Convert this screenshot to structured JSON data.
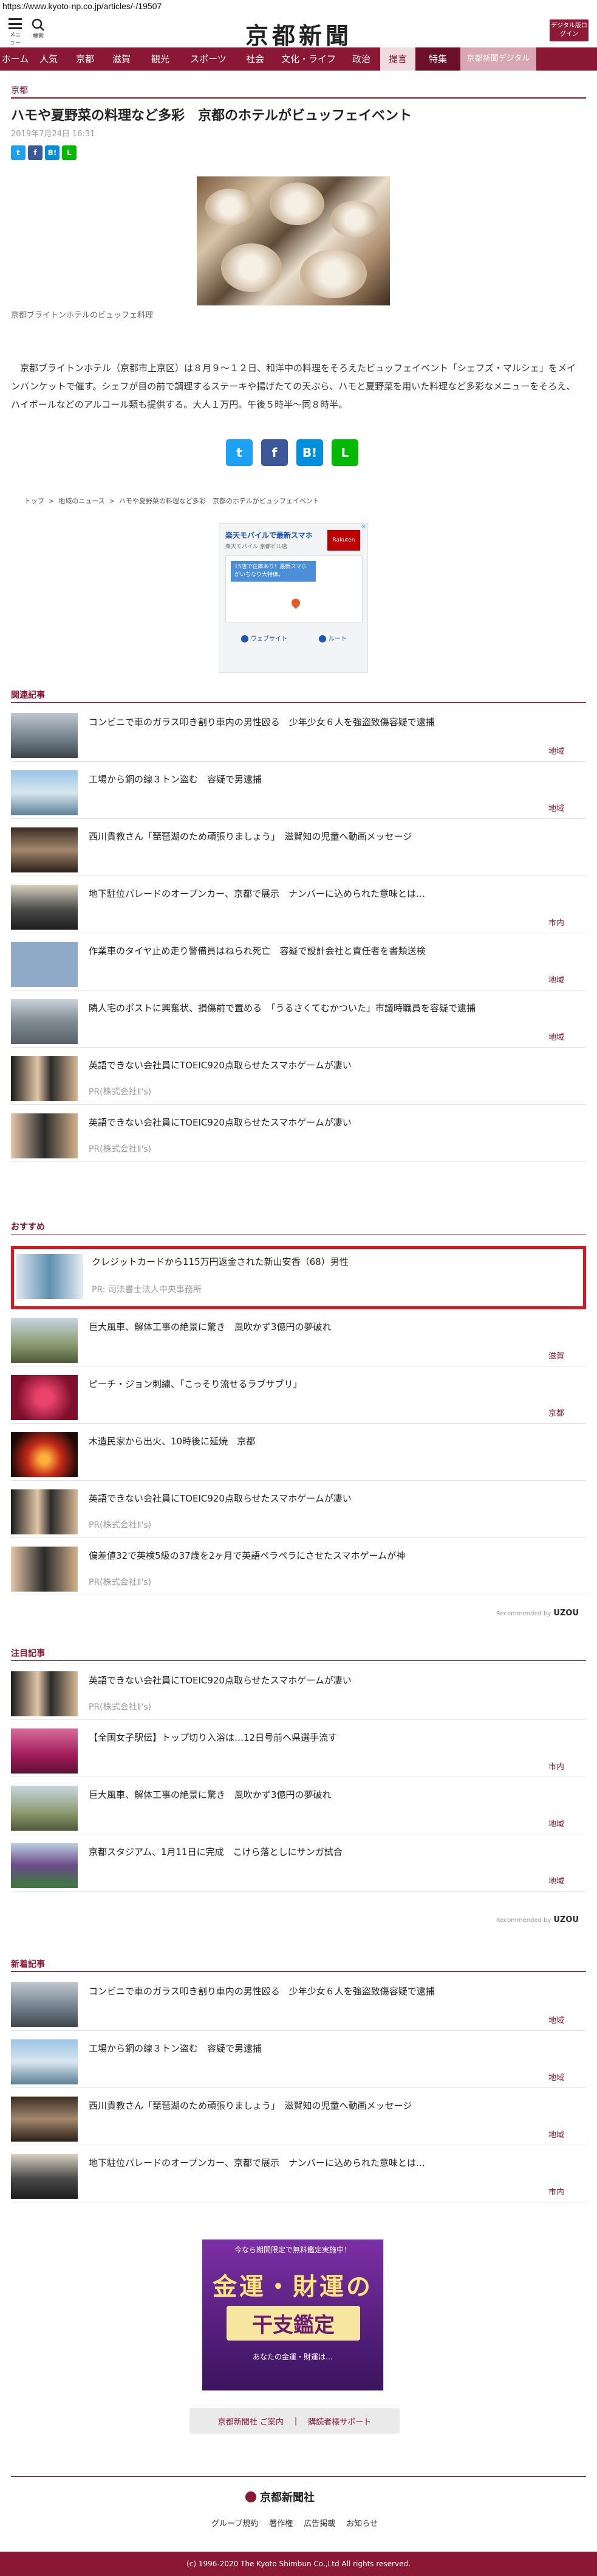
{
  "browser": {
    "url": "https://www.kyoto-np.co.jp/articles/-/19507"
  },
  "header": {
    "menu_label": "メニュー",
    "search_label": "検索",
    "logo_text": "京都新聞",
    "digital_button": "デジタル版ログイン"
  },
  "nav": {
    "items": [
      "ホーム",
      "人気",
      "京都",
      "滋賀",
      "観光",
      "スポーツ",
      "社会",
      "文化・ライフ",
      "政治",
      "提言",
      "特集",
      "京都新聞デジタル"
    ]
  },
  "article": {
    "category": "京都",
    "title": "ハモや夏野菜の料理など多彩　京都のホテルがビュッフェイベント",
    "date": "2019年7月24日 16:31",
    "photo_caption": "京都ブライトンホテルのビュッフェ料理",
    "body": "　京都ブライトンホテル（京都市上京区）は８月９～１２日、和洋中の料理をそろえたビュッフェイベント「シェフズ・マルシェ」をメインバンケットで催す。シェフが目の前で調理するステーキや揚げたての天ぷら、ハモと夏野菜を用いた料理など多彩なメニューをそろえ、ハイボールなどのアルコール類も提供する。大人１万円。午後５時半～同８時半。"
  },
  "share": {
    "twitter": "t",
    "facebook": "f",
    "hatena": "B!",
    "line": "L"
  },
  "breadcrumb": [
    "トップ",
    "地域のニュース",
    "ハモや夏野菜の料理など多彩　京都のホテルがビュッフェイベント"
  ],
  "ad": {
    "title": "楽天モバイルで最新スマホ",
    "sub": "楽天モバイル 京都ビル店",
    "logo": "Rakuten",
    "bubble": "15店で在庫あり！最新スマホがいちなり大特価。",
    "action_web": "ウェブサイト",
    "action_route": "ルート"
  },
  "related": {
    "heading": "関連記事",
    "items": [
      {
        "title": "コンビニで車のガラス叩き割り車内の男性殴る　少年少女６人を強盗致傷容疑で逮捕",
        "tag": "地域"
      },
      {
        "title": "工場から銅の線３トン盗む　容疑で男逮捕",
        "tag": "地域"
      },
      {
        "title": "西川貴教さん「琵琶湖のため頑張りましょう」　滋賀知の児童へ動画メッセージ",
        "tag": ""
      },
      {
        "title": "地下駐位パレードのオープンカー、京都で展示　ナンバーに込められた意味とは…",
        "tag": "市内"
      },
      {
        "title": "作業車のタイヤ止め走り警備員はねられ死亡　容疑で設計会社と責任者を書類送検",
        "tag": "地域"
      },
      {
        "title": "隣人宅のポストに興奮状、損傷前で置める　「うるさくてむかついた」市議時職員を容疑で逮捕",
        "tag": "地域"
      },
      {
        "title": "英語できない会社員にTOEIC920点取らせたスマホゲームが凄い",
        "pr": "PR(株式会社Ⅱ's)"
      },
      {
        "title": "英語できない会社員にTOEIC920点取らせたスマホゲームが凄い",
        "pr": "PR(株式会社Ⅱ's)"
      }
    ]
  },
  "recommend": {
    "heading": "おすすめ",
    "items": [
      {
        "title": "クレジットカードから115万円返金された新山安香（68）男性",
        "pr": "PR: 司法書士法人中央事務所"
      },
      {
        "title": "巨大風車、解体工事の絶景に驚き　風吹かず3億円の夢破れ",
        "tag": "滋賀"
      },
      {
        "title": "ピーチ・ジョン刺繍、「こっそり流せるラブサブリ」",
        "tag": "京都"
      },
      {
        "title": "木造民家から出火、10時後に延焼　京都",
        "tag": ""
      },
      {
        "title": "英語できない会社員にTOEIC920点取らせたスマホゲームが凄い",
        "pr": "PR(株式会社Ⅱ's)"
      },
      {
        "title": "偏差値32で英検5級の37歳を2ヶ月で英語ペラペラにさせたスマホゲームが神",
        "pr": "PR(株式会社Ⅱ's)"
      }
    ],
    "powered": "Recommended by",
    "powered_brand": "UZOU"
  },
  "popular": {
    "heading": "注目記事",
    "items": [
      {
        "title": "英語できない会社員にTOEIC920点取らせたスマホゲームが凄い",
        "pr": "PR(株式会社Ⅱ's)"
      },
      {
        "title": "【全国女子駅伝】トップ切り入浴は…12日号前へ県選手流す",
        "tag": "市内"
      },
      {
        "title": "巨大風車、解体工事の絶景に驚き　風吹かず3億円の夢破れ",
        "tag": "地域"
      },
      {
        "title": "京都スタジアム、1月11日に完成　こけら落としにサンガ試合",
        "tag": "地域"
      }
    ],
    "powered": "Recommended by",
    "powered_brand": "UZOU"
  },
  "latest": {
    "heading": "新着記事",
    "items": [
      {
        "title": "コンビニで車のガラス叩き割り車内の男性殴る　少年少女６人を強盗致傷容疑で逮捕",
        "tag": "地域"
      },
      {
        "title": "工場から銅の線３トン盗む　容疑で男逮捕",
        "tag": "地域"
      },
      {
        "title": "西川貴教さん「琵琶湖のため頑張りましょう」　滋賀知の児童へ動画メッセージ",
        "tag": "地域"
      },
      {
        "title": "地下駐位パレードのオープンカー、京都で展示　ナンバーに込められた意味とは…",
        "tag": "市内"
      }
    ]
  },
  "banner": {
    "line1": "今なら期間限定で無料鑑定実施中！",
    "line2": "金運・財運の",
    "line3": "干支鑑定",
    "line4": "あなたの金運・財運は…"
  },
  "footer": {
    "links": [
      "京都新聞社 ご案内",
      "購読者様サポート"
    ],
    "logo": "京都新聞社",
    "nav": [
      "グループ規約",
      "著作権",
      "広告掲載",
      "お知らせ"
    ],
    "copyright": "(c) 1996-2020 The Kyoto Shimbun Co.,Ltd All rights reserved."
  }
}
